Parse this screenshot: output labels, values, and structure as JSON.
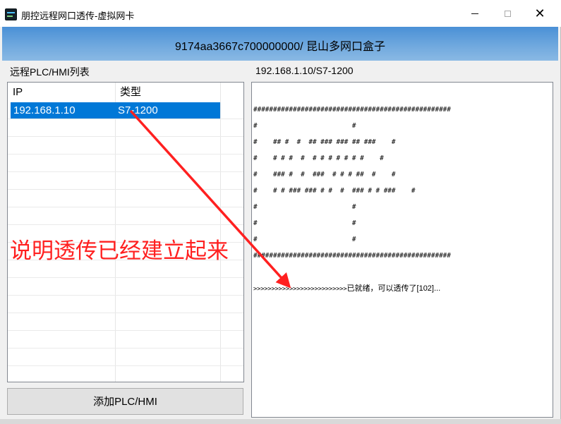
{
  "window": {
    "title": "朋控远程网口透传-虚拟网卡",
    "banner": "9174aa3667c700000000/ 昆山多网口盒子",
    "close_glyph": "✕"
  },
  "left_panel": {
    "title": "远程PLC/HMI列表",
    "columns": [
      "IP",
      "类型"
    ],
    "rows": [
      {
        "ip": "192.168.1.10",
        "type": "S7-1200",
        "selected": true
      }
    ],
    "add_button": "添加PLC/HMI"
  },
  "right_panel": {
    "title": "192.168.1.10/S7-1200",
    "console_lines": [
      "##################################################",
      "#                        #",
      "#    ## #  #  ## ### ### ## ###    #",
      "#    # # #  #  # # # # # # #    #",
      "#    ### #  #  ###  # # # ##  #    #",
      "#    # # ### ### # #  #  ### # # ###    #",
      "#                        #",
      "#                        #",
      "#                        #",
      "##################################################"
    ],
    "ready_prefix": ">>>>>>>>>>>>>>>>>>>>>>>>>>",
    "ready_message": "已就绪，可以透传了[102]..."
  },
  "annotation": {
    "text": "说明透传已经建立起来",
    "color": "#ff2020"
  },
  "colors": {
    "selection": "#0078d7",
    "banner_top": "#4a90d6",
    "banner_bottom": "#8ab9e4",
    "annotation": "#ff2020"
  }
}
